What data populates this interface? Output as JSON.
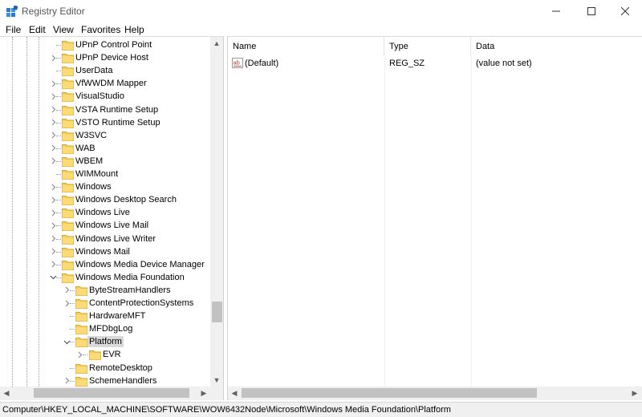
{
  "window": {
    "title": "Registry Editor",
    "minimize_icon": "minimize-icon",
    "maximize_icon": "maximize-icon",
    "close_icon": "close-icon"
  },
  "menu": [
    "File",
    "Edit",
    "View",
    "Favorites",
    "Help"
  ],
  "tree": {
    "rows": [
      {
        "label": "UPnP Control Point",
        "expandable": false,
        "depth": 0
      },
      {
        "label": "UPnP Device Host",
        "expandable": true,
        "depth": 0
      },
      {
        "label": "UserData",
        "expandable": false,
        "depth": 0
      },
      {
        "label": "VfWWDM Mapper",
        "expandable": true,
        "depth": 0
      },
      {
        "label": "VisualStudio",
        "expandable": true,
        "depth": 0
      },
      {
        "label": "VSTA Runtime Setup",
        "expandable": true,
        "depth": 0
      },
      {
        "label": "VSTO Runtime Setup",
        "expandable": true,
        "depth": 0
      },
      {
        "label": "W3SVC",
        "expandable": true,
        "depth": 0
      },
      {
        "label": "WAB",
        "expandable": true,
        "depth": 0
      },
      {
        "label": "WBEM",
        "expandable": true,
        "depth": 0
      },
      {
        "label": "WIMMount",
        "expandable": false,
        "depth": 0
      },
      {
        "label": "Windows",
        "expandable": true,
        "depth": 0
      },
      {
        "label": "Windows Desktop Search",
        "expandable": true,
        "depth": 0
      },
      {
        "label": "Windows Live",
        "expandable": true,
        "depth": 0
      },
      {
        "label": "Windows Live Mail",
        "expandable": true,
        "depth": 0
      },
      {
        "label": "Windows Live Writer",
        "expandable": true,
        "depth": 0
      },
      {
        "label": "Windows Mail",
        "expandable": true,
        "depth": 0
      },
      {
        "label": "Windows Media Device Manager",
        "expandable": true,
        "depth": 0
      },
      {
        "label": "Windows Media Foundation",
        "expandable": true,
        "expanded": true,
        "depth": 0
      },
      {
        "label": "ByteStreamHandlers",
        "expandable": true,
        "depth": 1
      },
      {
        "label": "ContentProtectionSystems",
        "expandable": true,
        "depth": 1
      },
      {
        "label": "HardwareMFT",
        "expandable": false,
        "depth": 1
      },
      {
        "label": "MFDbgLog",
        "expandable": false,
        "depth": 1
      },
      {
        "label": "Platform",
        "expandable": true,
        "expanded": true,
        "selected": true,
        "depth": 1
      },
      {
        "label": "EVR",
        "expandable": true,
        "depth": 2
      },
      {
        "label": "RemoteDesktop",
        "expandable": false,
        "depth": 1
      },
      {
        "label": "SchemeHandlers",
        "expandable": true,
        "depth": 1
      }
    ]
  },
  "values": {
    "columns": [
      "Name",
      "Type",
      "Data"
    ],
    "rows": [
      {
        "name": "(Default)",
        "type": "REG_SZ",
        "data": "(value not set)",
        "icon": "string-value-icon"
      }
    ]
  },
  "status": {
    "path": "Computer\\HKEY_LOCAL_MACHINE\\SOFTWARE\\WOW6432Node\\Microsoft\\Windows Media Foundation\\Platform"
  }
}
